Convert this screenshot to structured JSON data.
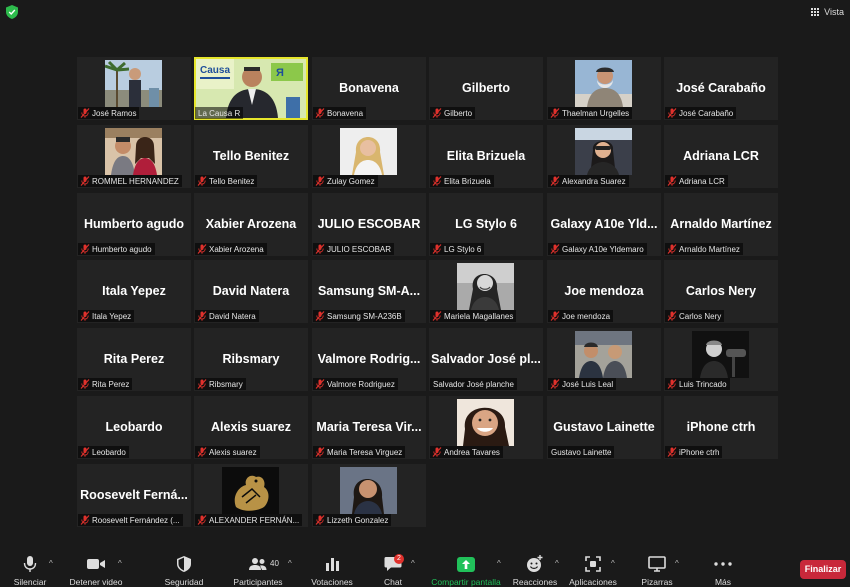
{
  "topbar": {
    "view_label": "Vista"
  },
  "participants": [
    {
      "display": "",
      "label": "José Ramos",
      "video": true,
      "muted": true,
      "photo": "palm"
    },
    {
      "display": "",
      "label": "La Causa R",
      "video": true,
      "muted": false,
      "photo": "lacausa",
      "active": true
    },
    {
      "display": "Bonavena",
      "label": "Bonavena",
      "video": false,
      "muted": true
    },
    {
      "display": "Gilberto",
      "label": "Gilberto",
      "video": false,
      "muted": true
    },
    {
      "display": "",
      "label": "Thaelman Urgelles",
      "video": true,
      "muted": true,
      "photo": "man-sky"
    },
    {
      "display": "José Carabaño",
      "label": "José Carabaño",
      "video": false,
      "muted": true
    },
    {
      "display": "",
      "label": "ROMMEL HERNANDEZ",
      "video": true,
      "muted": true,
      "photo": "couple"
    },
    {
      "display": "Tello Benitez",
      "label": "Tello Benitez",
      "video": false,
      "muted": true
    },
    {
      "display": "",
      "label": "Zulay Gomez",
      "video": true,
      "muted": true,
      "photo": "woman-blonde"
    },
    {
      "display": "Elita Brizuela",
      "label": "Elita Brizuela",
      "video": false,
      "muted": true
    },
    {
      "display": "",
      "label": "Alexandra Suarez",
      "video": true,
      "muted": true,
      "photo": "car-selfie"
    },
    {
      "display": "Adriana LCR",
      "label": "Adriana LCR",
      "video": false,
      "muted": true
    },
    {
      "display": "Humberto agudo",
      "label": "Humberto agudo",
      "video": false,
      "muted": true
    },
    {
      "display": "Xabier Arozena",
      "label": "Xabier Arozena",
      "video": false,
      "muted": true
    },
    {
      "display": "JULIO ESCOBAR",
      "label": "JULIO ESCOBAR",
      "video": false,
      "muted": true
    },
    {
      "display": "LG Stylo 6",
      "label": "LG Stylo 6",
      "video": false,
      "muted": true
    },
    {
      "display": "Galaxy A10e Yld...",
      "label": "Galaxy A10e Yldemaro",
      "video": false,
      "muted": true
    },
    {
      "display": "Arnaldo Martínez",
      "label": "Arnaldo Martínez",
      "video": false,
      "muted": true
    },
    {
      "display": "Itala Yepez",
      "label": "Itala Yepez",
      "video": false,
      "muted": true
    },
    {
      "display": "David Natera",
      "label": "David Natera",
      "video": false,
      "muted": true
    },
    {
      "display": "Samsung SM-A...",
      "label": "Samsung SM-A236B",
      "video": false,
      "muted": true
    },
    {
      "display": "",
      "label": "Mariela Magallanes",
      "video": true,
      "muted": true,
      "photo": "woman-bw"
    },
    {
      "display": "Joe mendoza",
      "label": "Joe mendoza",
      "video": false,
      "muted": true
    },
    {
      "display": "Carlos Nery",
      "label": "Carlos Nery",
      "video": false,
      "muted": true
    },
    {
      "display": "Rita Perez",
      "label": "Rita Perez",
      "video": false,
      "muted": true
    },
    {
      "display": "Ribsmary",
      "label": "Ribsmary",
      "video": false,
      "muted": true
    },
    {
      "display": "Valmore Rodrig...",
      "label": "Valmore Rodriguez",
      "video": false,
      "muted": true
    },
    {
      "display": "Salvador José pl...",
      "label": "Salvador José planche",
      "video": false,
      "muted": false
    },
    {
      "display": "",
      "label": "José Luis Leal",
      "video": true,
      "muted": true,
      "photo": "men-group"
    },
    {
      "display": "",
      "label": "Luis Trincado",
      "video": true,
      "muted": true,
      "photo": "man-mic"
    },
    {
      "display": "Leobardo",
      "label": "Leobardo",
      "video": false,
      "muted": true
    },
    {
      "display": "Alexis suarez",
      "label": "Alexis suarez",
      "video": false,
      "muted": true
    },
    {
      "display": "Maria Teresa Vir...",
      "label": "Maria Teresa Virguez",
      "video": false,
      "muted": true
    },
    {
      "display": "",
      "label": "Andrea Tavares",
      "video": true,
      "muted": true,
      "photo": "woman-smile"
    },
    {
      "display": "Gustavo Lainette",
      "label": "Gustavo Lainette",
      "video": false,
      "muted": false
    },
    {
      "display": "iPhone ctrh",
      "label": "iPhone ctrh",
      "video": false,
      "muted": true
    },
    {
      "display": "Roosevelt Ferná...",
      "label": "Roosevelt Fernández (...",
      "video": false,
      "muted": true
    },
    {
      "display": "",
      "label": "ALEXANDER FERNÁN...",
      "video": true,
      "muted": true,
      "photo": "dragon"
    },
    {
      "display": "",
      "label": "Lizzeth Gonzalez",
      "video": true,
      "muted": true,
      "photo": "woman-dark"
    }
  ],
  "toolbar": {
    "mute_label": "Silenciar",
    "video_label": "Detener video",
    "security_label": "Seguridad",
    "participants_label": "Participantes",
    "participants_count": "40",
    "polls_label": "Votaciones",
    "chat_label": "Chat",
    "chat_badge": "2",
    "share_label": "Compartir pantalla",
    "reactions_label": "Reacciones",
    "apps_label": "Aplicaciones",
    "whiteboards_label": "Pizarras",
    "more_label": "Más",
    "end_label": "Finalizar"
  },
  "colors": {
    "active_speaker": "#e6e62c",
    "share_green": "#21c15a",
    "end_red": "#c8283a",
    "muted_red": "#e0312c"
  }
}
